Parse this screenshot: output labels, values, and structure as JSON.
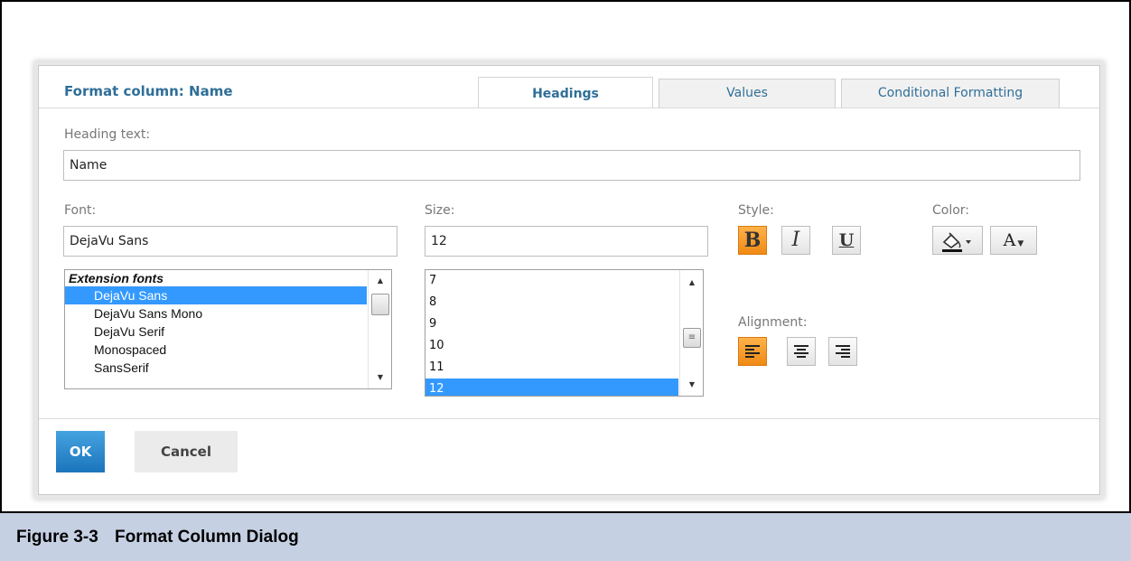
{
  "dialog": {
    "title": "Format column: Name",
    "tabs": [
      {
        "label": "Headings",
        "active": true
      },
      {
        "label": "Values",
        "active": false
      },
      {
        "label": "Conditional Formatting",
        "active": false
      }
    ],
    "heading_text": {
      "label": "Heading text:",
      "value": "Name"
    },
    "font": {
      "label": "Font:",
      "value": "DejaVu Sans",
      "list_group": "Extension fonts",
      "options": [
        "DejaVu Sans",
        "DejaVu Sans Mono",
        "DejaVu Serif",
        "Monospaced",
        "SansSerif"
      ],
      "selected": "DejaVu Sans"
    },
    "size": {
      "label": "Size:",
      "value": "12",
      "options": [
        "7",
        "8",
        "9",
        "10",
        "11",
        "12"
      ],
      "selected": "12"
    },
    "style": {
      "label": "Style:",
      "bold": {
        "glyph": "B",
        "active": true
      },
      "italic": {
        "glyph": "I",
        "active": false
      },
      "underline": {
        "glyph": "U",
        "active": false
      }
    },
    "color": {
      "label": "Color:",
      "background_icon": "paint-bucket-icon",
      "text_glyph": "A"
    },
    "alignment": {
      "label": "Alignment:",
      "options": [
        "left",
        "center",
        "right"
      ],
      "selected": "left"
    },
    "buttons": {
      "ok": "OK",
      "cancel": "Cancel"
    }
  },
  "caption": {
    "number": "Figure 3-3",
    "title": "Format Column Dialog"
  },
  "colors": {
    "accent": "#f08a14",
    "link": "#2f6f98",
    "selection": "#3399ff",
    "primary_button": "#1b75bb",
    "caption_bg": "#c5d0e3"
  }
}
